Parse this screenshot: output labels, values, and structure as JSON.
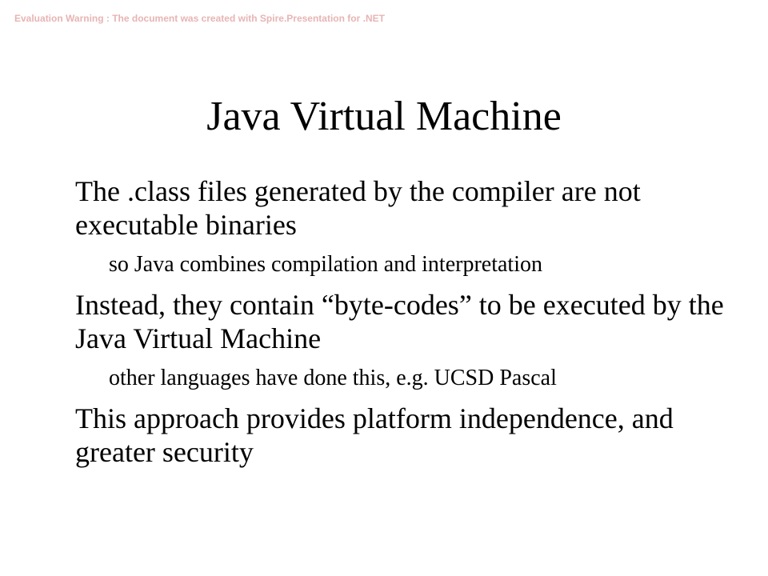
{
  "watermark": "Evaluation Warning : The document was created with  Spire.Presentation for .NET",
  "slide": {
    "title": "Java Virtual Machine",
    "bullets": [
      {
        "level": 1,
        "text": "The .class files generated by the compiler are not executable binaries"
      },
      {
        "level": 2,
        "text": "so Java combines compilation and interpretation"
      },
      {
        "level": 1,
        "text": "Instead, they contain “byte-codes” to be executed by the Java Virtual Machine"
      },
      {
        "level": 2,
        "text": "other languages have done this, e.g. UCSD Pascal"
      },
      {
        "level": 1,
        "text": "This approach provides platform independence, and greater security"
      }
    ]
  }
}
